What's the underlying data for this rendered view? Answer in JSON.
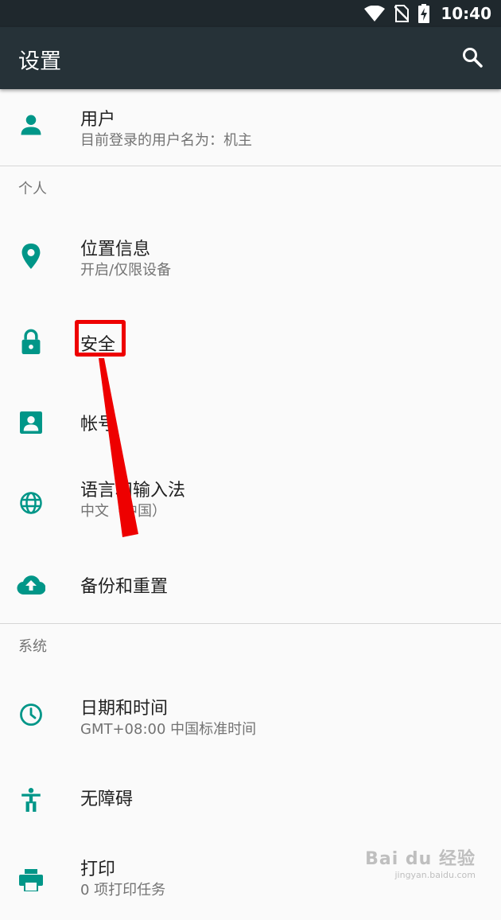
{
  "status_bar": {
    "time": "10:40",
    "icons": [
      "wifi-icon",
      "no-sim-icon",
      "battery-charging-icon"
    ]
  },
  "app_bar": {
    "title": "设置",
    "search_icon": "search-icon"
  },
  "user_item": {
    "title": "用户",
    "subtitle": "目前登录的用户名为：机主",
    "icon": "person-icon"
  },
  "sections": [
    {
      "header": "个人",
      "items": [
        {
          "title": "位置信息",
          "subtitle": "开启/仅限设备",
          "icon": "location-icon"
        },
        {
          "title": "安全",
          "icon": "lock-icon"
        },
        {
          "title": "帐号",
          "icon": "account-icon"
        },
        {
          "title": "语言和输入法",
          "subtitle": "中文（中国）",
          "icon": "globe-icon"
        },
        {
          "title": "备份和重置",
          "icon": "cloud-upload-icon"
        }
      ]
    },
    {
      "header": "系统",
      "items": [
        {
          "title": "日期和时间",
          "subtitle": "GMT+08:00 中国标准时间",
          "icon": "clock-icon"
        },
        {
          "title": "无障碍",
          "icon": "accessibility-icon"
        },
        {
          "title": "打印",
          "subtitle": "0 项打印任务",
          "icon": "print-icon"
        }
      ]
    }
  ],
  "annotation": {
    "highlight_color": "#ee0000"
  },
  "watermark": {
    "main": "Bai du 经验",
    "sub": "jingyan.baidu.com"
  },
  "colors": {
    "accent": "#009688",
    "app_bar": "#263238",
    "status_bar": "#1f282d"
  }
}
